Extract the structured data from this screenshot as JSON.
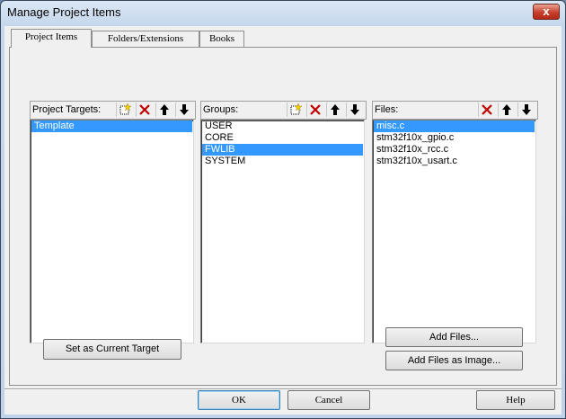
{
  "window": {
    "title": "Manage Project Items",
    "close_glyph": "x"
  },
  "tabs": [
    {
      "label": "Project Items",
      "active": true
    },
    {
      "label": "Folders/Extensions",
      "active": false
    },
    {
      "label": "Books",
      "active": false
    }
  ],
  "targets": {
    "label": "Project Targets:",
    "items": [
      "Template"
    ],
    "selected": "Template"
  },
  "groups": {
    "label": "Groups:",
    "items": [
      "USER",
      "CORE",
      "FWLIB",
      "SYSTEM"
    ],
    "selected": "FWLIB"
  },
  "files": {
    "label": "Files:",
    "items": [
      "misc.c",
      "stm32f10x_gpio.c",
      "stm32f10x_rcc.c",
      "stm32f10x_usart.c"
    ],
    "selected": "misc.c"
  },
  "buttons": {
    "set_current": "Set as Current Target",
    "add_files": "Add Files...",
    "add_files_image": "Add Files as Image...",
    "ok": "OK",
    "cancel": "Cancel",
    "help": "Help"
  },
  "icons": [
    "new-item-icon",
    "delete-icon",
    "move-up-icon",
    "move-down-icon",
    "close-icon"
  ]
}
